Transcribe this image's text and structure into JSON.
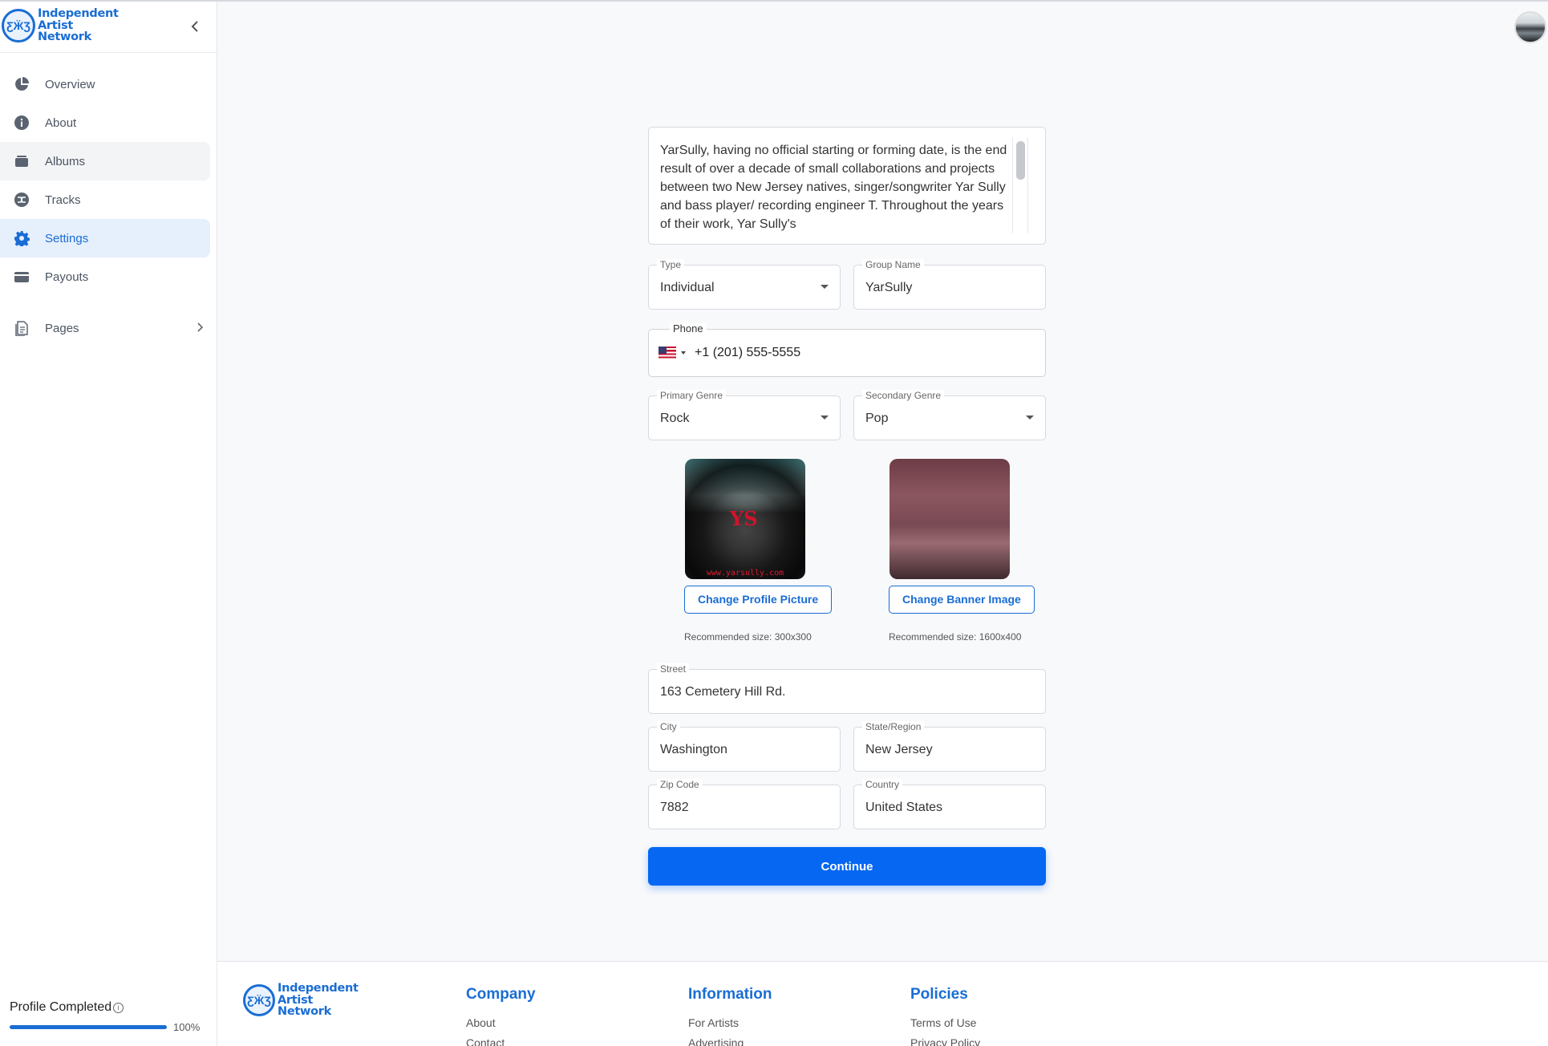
{
  "brand": {
    "name_line1": "Independent",
    "name_line2": "Artist",
    "name_line3": "Network",
    "accent": "#1a6dd4"
  },
  "sidebar": {
    "items": [
      {
        "label": "Overview",
        "icon": "pie-chart-icon"
      },
      {
        "label": "About",
        "icon": "info-icon"
      },
      {
        "label": "Albums",
        "icon": "album-stack-icon"
      },
      {
        "label": "Tracks",
        "icon": "shuffle-icon"
      },
      {
        "label": "Settings",
        "icon": "gear-icon"
      },
      {
        "label": "Payouts",
        "icon": "credit-card-icon"
      },
      {
        "label": "Pages",
        "icon": "pages-icon"
      }
    ],
    "active": "Settings",
    "profile_completed_label": "Profile Completed",
    "profile_completed_value": "100%",
    "profile_completed_fraction": 1.0
  },
  "form": {
    "bio": "YarSully, having no official starting or forming date, is the end result of over a decade of small collaborations and projects between two New Jersey natives, singer/songwriter Yar Sully and bass player/ recording engineer T. Throughout the years of their work, Yar Sully's",
    "type": {
      "label": "Type",
      "value": "Individual"
    },
    "group_name": {
      "label": "Group Name",
      "value": "YarSully"
    },
    "phone": {
      "label": "Phone",
      "value": "+1 (201) 555-5555"
    },
    "primary_genre": {
      "label": "Primary Genre",
      "value": "Rock"
    },
    "secondary_genre": {
      "label": "Secondary Genre",
      "value": "Pop"
    },
    "profile_picture": {
      "button": "Change Profile Picture",
      "recommended": "Recommended size: 300x300",
      "overlay_text": "YS",
      "overlay_url": "www.yarsully.com"
    },
    "banner_image": {
      "button": "Change Banner Image",
      "recommended": "Recommended size: 1600x400"
    },
    "street": {
      "label": "Street",
      "value": "163 Cemetery Hill Rd."
    },
    "city": {
      "label": "City",
      "value": "Washington"
    },
    "state": {
      "label": "State/Region",
      "value": "New Jersey"
    },
    "zip": {
      "label": "Zip Code",
      "value": "7882"
    },
    "country": {
      "label": "Country",
      "value": "United States"
    },
    "continue_label": "Continue"
  },
  "footer": {
    "company": {
      "heading": "Company",
      "links": [
        "About",
        "Contact"
      ]
    },
    "information": {
      "heading": "Information",
      "links": [
        "For Artists",
        "Advertising"
      ]
    },
    "policies": {
      "heading": "Policies",
      "links": [
        "Terms of Use",
        "Privacy Policy"
      ]
    }
  }
}
